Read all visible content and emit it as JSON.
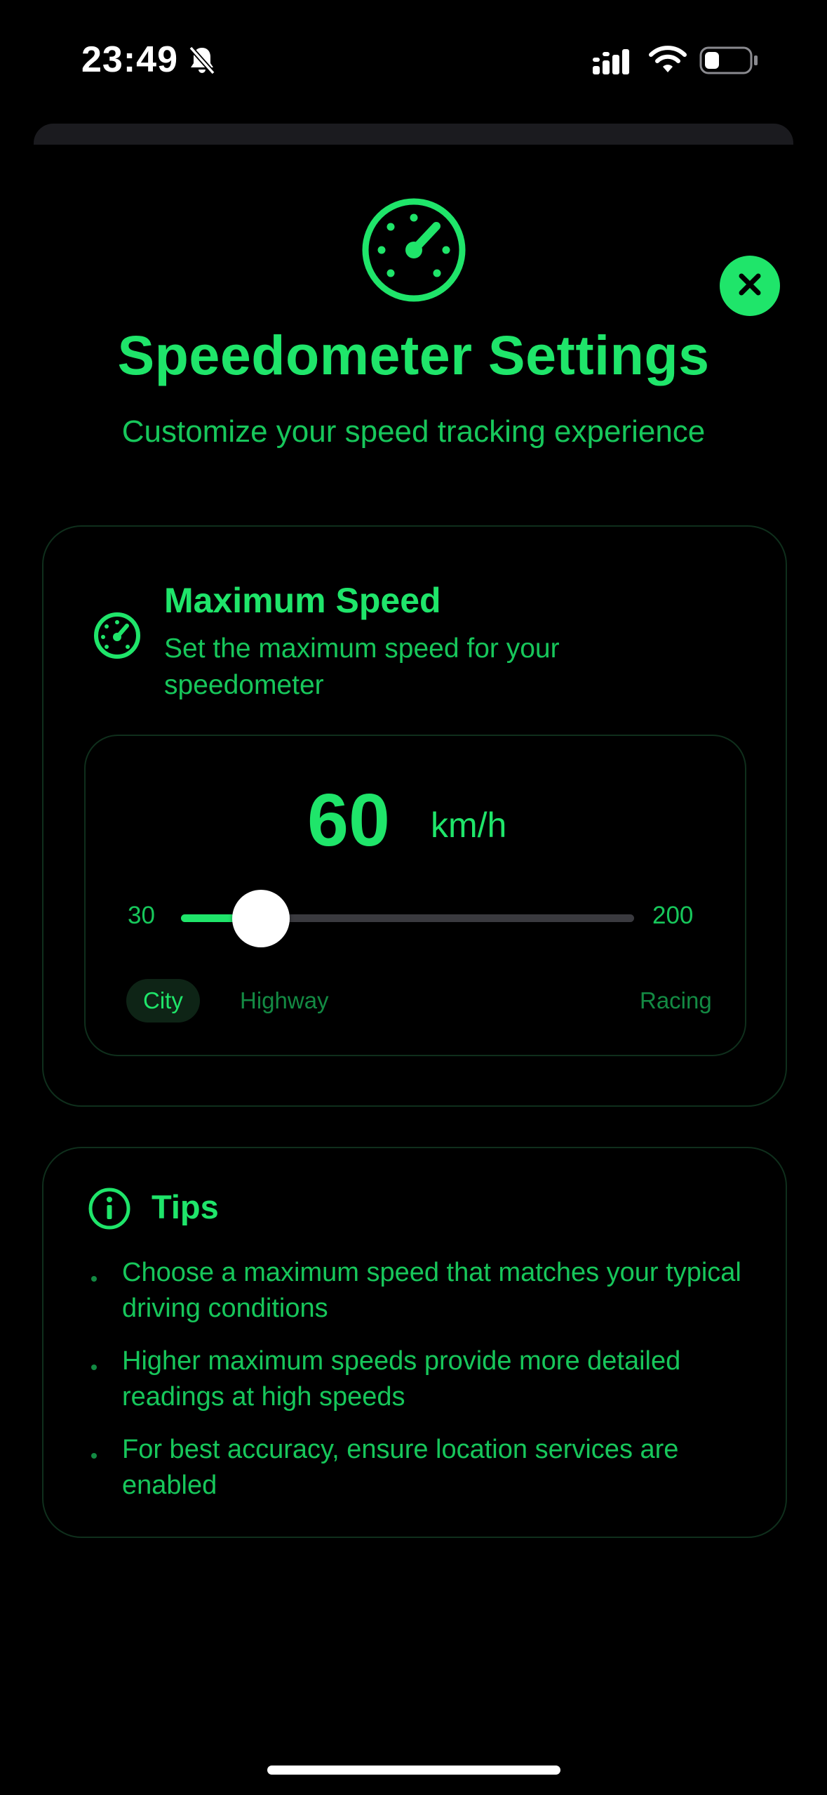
{
  "status_bar": {
    "time": "23:49",
    "icons": [
      "bell-slash-icon",
      "cellular-signal-icon",
      "wifi-icon",
      "battery-icon"
    ]
  },
  "header": {
    "icon": "speedometer-icon",
    "title": "Speedometer Settings",
    "subtitle": "Customize your speed tracking experience",
    "close_icon": "close-icon"
  },
  "max_speed_card": {
    "icon": "speedometer-icon",
    "title": "Maximum Speed",
    "description": "Set the maximum speed for your speedometer",
    "value": "60",
    "unit": "km/h",
    "slider": {
      "min": 30,
      "max": 200,
      "value": 60,
      "min_label": "30",
      "max_label": "200"
    },
    "presets": [
      {
        "label": "City",
        "selected": true
      },
      {
        "label": "Highway",
        "selected": false
      },
      {
        "label": "Racing",
        "selected": false
      }
    ]
  },
  "tips_card": {
    "icon": "info-icon",
    "title": "Tips",
    "items": [
      "Choose a maximum speed that matches your typical driving conditions",
      "Higher maximum speeds provide more detailed readings at high speeds",
      "For best accuracy, ensure location services are enabled"
    ]
  },
  "colors": {
    "accent": "#1fe56a",
    "text_secondary": "#17c75b",
    "background": "#000000",
    "card_border": "#0f2f1c"
  }
}
